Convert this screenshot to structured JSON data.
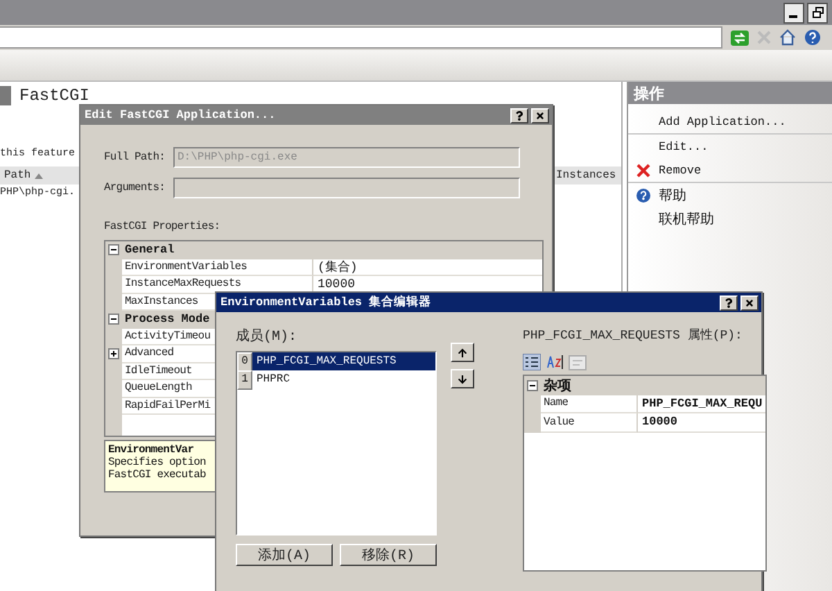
{
  "main": {
    "title": "FastCGI",
    "description": "this feature",
    "columns": [
      {
        "label": "Path",
        "sorted": true
      },
      {
        "label": "Instances",
        "sorted": false
      }
    ],
    "row": "PHP\\php-cgi."
  },
  "actions": {
    "title": "操作",
    "items": [
      {
        "label": "Add Application...",
        "kind": "plain"
      },
      {
        "label": "Edit...",
        "kind": "plain"
      },
      {
        "label": "Remove",
        "kind": "remove"
      },
      {
        "label": "帮助",
        "kind": "help"
      },
      {
        "label": "联机帮助",
        "kind": "plain"
      }
    ]
  },
  "edit_dialog": {
    "title": "Edit FastCGI Application...",
    "full_path_label": "Full Path:",
    "full_path": "D:\\PHP\\php-cgi.exe",
    "arguments_label": "Arguments:",
    "properties_label": "FastCGI Properties:",
    "grid": [
      {
        "name": "General",
        "expanded": true,
        "children": [
          {
            "name": "EnvironmentVariables",
            "value": "(集合)",
            "kind": "property"
          },
          {
            "name": "InstanceMaxRequests",
            "value": "10000",
            "kind": "property"
          },
          {
            "name": "MaxInstances",
            "kind": "property"
          }
        ]
      },
      {
        "name": "Process Mode",
        "expanded": true,
        "children": [
          {
            "name": "ActivityTimeou",
            "kind": "property"
          },
          {
            "name": "Advanced",
            "kind": "group",
            "expanded": false
          },
          {
            "name": "IdleTimeout",
            "kind": "property"
          },
          {
            "name": "QueueLength",
            "kind": "property"
          },
          {
            "name": "RapidFailPerMi",
            "kind": "property"
          }
        ]
      }
    ],
    "description_title": "EnvironmentVar",
    "description": [
      "Specifies option",
      "FastCGI executab"
    ]
  },
  "collection_editor": {
    "title": "EnvironmentVariables 集合编辑器",
    "members_label": "成员(M):",
    "members": [
      {
        "index": "0",
        "name": "PHP_FCGI_MAX_REQUESTS",
        "selected": true
      },
      {
        "index": "1",
        "name": "PHPRC",
        "selected": false
      }
    ],
    "buttons": [
      "添加(A)",
      "移除(R)"
    ],
    "properties_label": "PHP_FCGI_MAX_REQUESTS 属性(P):",
    "grid": [
      {
        "name": "杂项",
        "expanded": true,
        "children": [
          {
            "name": "Name",
            "value": "PHP_FCGI_MAX_REQU"
          },
          {
            "name": "Value",
            "value": "10000"
          }
        ]
      }
    ]
  }
}
